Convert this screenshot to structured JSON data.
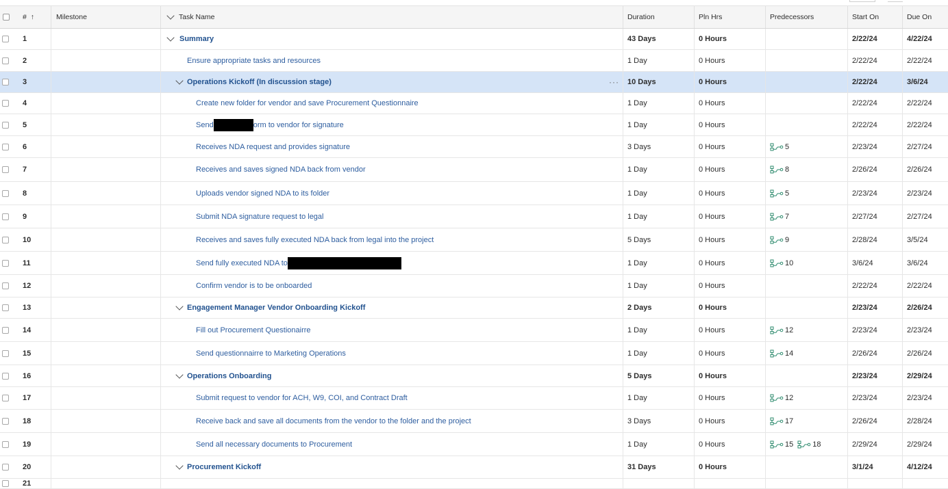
{
  "columns": {
    "number": "#",
    "sort_indicator": "↑",
    "milestone": "Milestone",
    "task_name": "Task Name",
    "duration": "Duration",
    "pln_hrs": "Pln Hrs",
    "predecessors": "Predecessors",
    "start_on": "Start On",
    "due_on": "Due On"
  },
  "rows": [
    {
      "num": "1",
      "task": "Summary",
      "duration": "43 Days",
      "hrs": "0 Hours",
      "preds": [],
      "start": "2/22/24",
      "due": "4/22/24",
      "bold": true,
      "indent": 0,
      "chevron": true
    },
    {
      "num": "2",
      "task": "Ensure appropriate tasks and resources",
      "duration": "1 Day",
      "hrs": "0 Hours",
      "preds": [],
      "start": "2/22/24",
      "due": "2/22/24",
      "bold": false,
      "indent": 1,
      "chevron": false
    },
    {
      "num": "3",
      "task": "Operations Kickoff (In discussion stage)",
      "duration": "10 Days",
      "hrs": "0 Hours",
      "preds": [],
      "start": "2/22/24",
      "due": "3/6/24",
      "bold": true,
      "indent": 1,
      "chevron": true,
      "selected": true,
      "more": "···"
    },
    {
      "num": "4",
      "task": "Create new folder for vendor and save Procurement Questionnaire",
      "duration": "1 Day",
      "hrs": "0 Hours",
      "preds": [],
      "start": "2/22/24",
      "due": "2/22/24",
      "bold": false,
      "indent": 2
    },
    {
      "num": "5",
      "task_a": "Send",
      "task_b": "orm to vendor for signature",
      "redact_w": 58,
      "duration": "1 Day",
      "hrs": "0 Hours",
      "preds": [],
      "start": "2/22/24",
      "due": "2/22/24",
      "bold": false,
      "indent": 2
    },
    {
      "num": "6",
      "task": "Receives NDA request and provides signature",
      "duration": "3 Days",
      "hrs": "0 Hours",
      "preds": [
        "5"
      ],
      "start": "2/23/24",
      "due": "2/27/24",
      "bold": false,
      "indent": 2
    },
    {
      "num": "7",
      "task": "Receives and saves signed NDA back from vendor",
      "duration": "1 Day",
      "hrs": "0 Hours",
      "preds": [
        "8"
      ],
      "start": "2/26/24",
      "due": "2/26/24",
      "bold": false,
      "indent": 2
    },
    {
      "num": "8",
      "task": "Uploads vendor signed NDA to its folder",
      "duration": "1 Day",
      "hrs": "0 Hours",
      "preds": [
        "5"
      ],
      "start": "2/23/24",
      "due": "2/23/24",
      "bold": false,
      "indent": 2
    },
    {
      "num": "9",
      "task": "Submit NDA signature request to legal",
      "duration": "1 Day",
      "hrs": "0 Hours",
      "preds": [
        "7"
      ],
      "start": "2/27/24",
      "due": "2/27/24",
      "bold": false,
      "indent": 2
    },
    {
      "num": "10",
      "task": "Receives and saves fully executed NDA back from legal into the project",
      "duration": "5 Days",
      "hrs": "0 Hours",
      "preds": [
        "9"
      ],
      "start": "2/28/24",
      "due": "3/5/24",
      "bold": false,
      "indent": 2
    },
    {
      "num": "11",
      "task_a": "Send fully executed NDA to",
      "task_b": "",
      "redact_w": 166,
      "duration": "1 Day",
      "hrs": "0 Hours",
      "preds": [
        "10"
      ],
      "start": "3/6/24",
      "due": "3/6/24",
      "bold": false,
      "indent": 2
    },
    {
      "num": "12",
      "task": "Confirm vendor is to be onboarded",
      "duration": "1 Day",
      "hrs": "0 Hours",
      "preds": [],
      "start": "2/22/24",
      "due": "2/22/24",
      "bold": false,
      "indent": 2
    },
    {
      "num": "13",
      "task": "Engagement Manager Vendor Onboarding Kickoff",
      "duration": "2 Days",
      "hrs": "0 Hours",
      "preds": [],
      "start": "2/23/24",
      "due": "2/26/24",
      "bold": true,
      "indent": 1,
      "chevron": true
    },
    {
      "num": "14",
      "task": "Fill out Procurement Questionairre",
      "duration": "1 Day",
      "hrs": "0 Hours",
      "preds": [
        "12"
      ],
      "start": "2/23/24",
      "due": "2/23/24",
      "bold": false,
      "indent": 2
    },
    {
      "num": "15",
      "task": "Send questionnairre to Marketing Operations",
      "duration": "1 Day",
      "hrs": "0 Hours",
      "preds": [
        "14"
      ],
      "start": "2/26/24",
      "due": "2/26/24",
      "bold": false,
      "indent": 2
    },
    {
      "num": "16",
      "task": "Operations Onboarding",
      "duration": "5 Days",
      "hrs": "0 Hours",
      "preds": [],
      "start": "2/23/24",
      "due": "2/29/24",
      "bold": true,
      "indent": 1,
      "chevron": true
    },
    {
      "num": "17",
      "task": "Submit request to vendor for ACH, W9, COI, and Contract Draft",
      "duration": "1 Day",
      "hrs": "0 Hours",
      "preds": [
        "12"
      ],
      "start": "2/23/24",
      "due": "2/23/24",
      "bold": false,
      "indent": 2
    },
    {
      "num": "18",
      "task": "Receive back and save all documents from the vendor to the folder and the project",
      "duration": "3 Days",
      "hrs": "0 Hours",
      "preds": [
        "17"
      ],
      "start": "2/26/24",
      "due": "2/28/24",
      "bold": false,
      "indent": 2
    },
    {
      "num": "19",
      "task": "Send all necessary documents to Procurement",
      "duration": "1 Day",
      "hrs": "0 Hours",
      "preds": [
        "15",
        "18"
      ],
      "start": "2/29/24",
      "due": "2/29/24",
      "bold": false,
      "indent": 2
    },
    {
      "num": "20",
      "task": "Procurement Kickoff",
      "duration": "31 Days",
      "hrs": "0 Hours",
      "preds": [],
      "start": "3/1/24",
      "due": "4/12/24",
      "bold": true,
      "indent": 1,
      "chevron": true
    },
    {
      "num": "21",
      "task": "",
      "duration": "",
      "hrs": "",
      "preds": [],
      "start": "",
      "due": "",
      "bold": false,
      "indent": 2,
      "partial": true
    }
  ]
}
